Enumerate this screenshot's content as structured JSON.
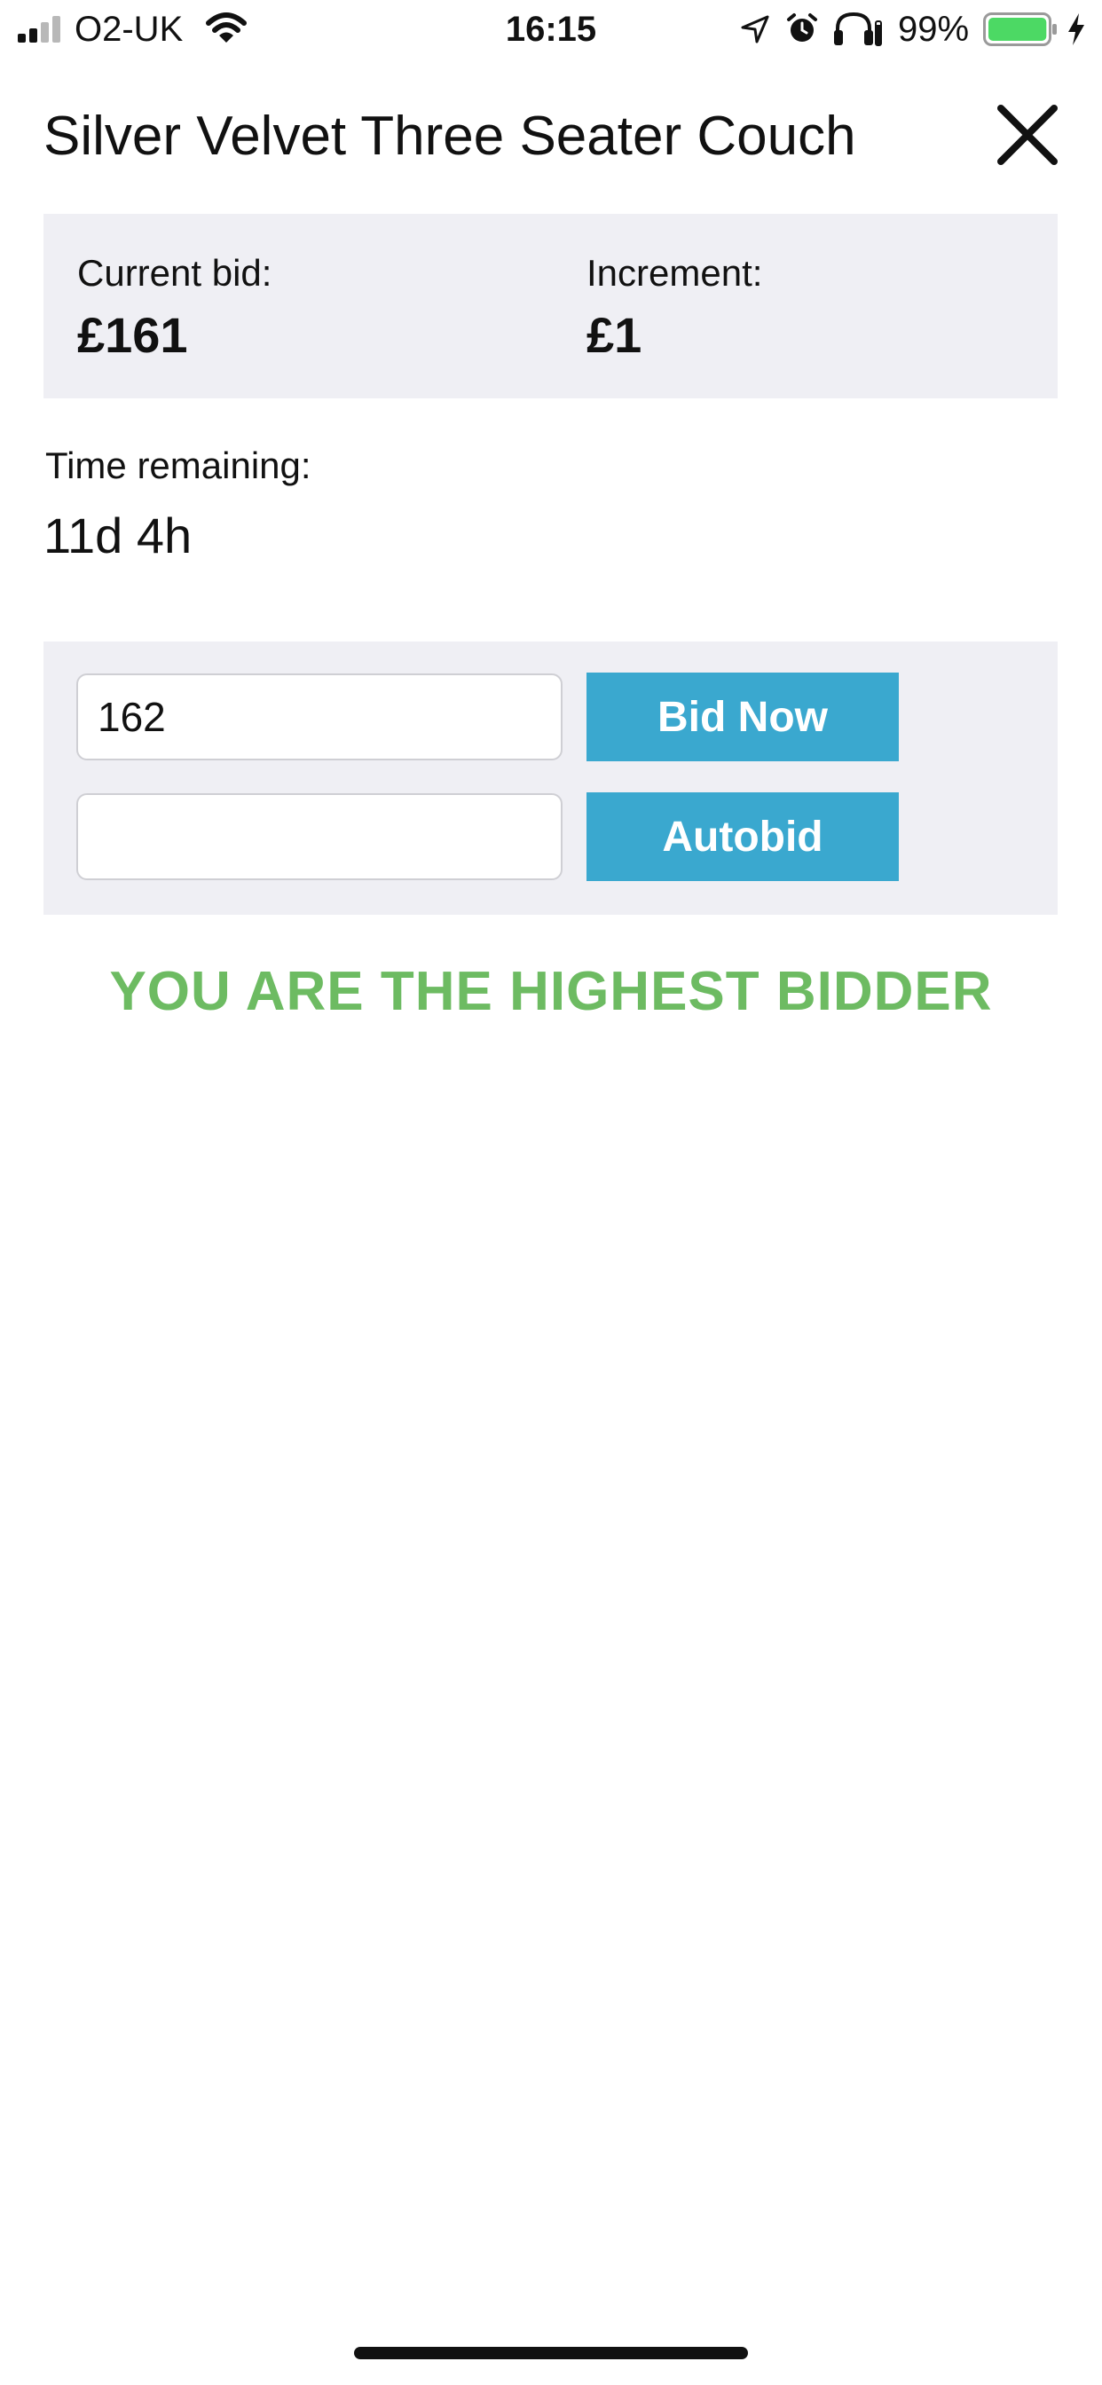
{
  "status_bar": {
    "carrier": "O2-UK",
    "time": "16:15",
    "battery_percent": "99%",
    "battery_level": 0.99,
    "icons": [
      "signal-icon",
      "wifi-icon",
      "location-arrow-icon",
      "alarm-icon",
      "headphones-icon",
      "battery-icon",
      "charging-icon"
    ]
  },
  "header": {
    "title": "Silver Velvet Three Seater Couch",
    "close_icon": "close-icon"
  },
  "bid_info": {
    "current_bid_label": "Current bid:",
    "current_bid_value": "£161",
    "increment_label": "Increment:",
    "increment_value": "£1"
  },
  "time_remaining": {
    "label": "Time remaining:",
    "value": "11d 4h"
  },
  "bid_form": {
    "bid_amount_value": "162",
    "bid_now_label": "Bid Now",
    "autobid_value": "",
    "autobid_label": "Autobid"
  },
  "status_message": "YOU ARE THE HIGHEST BIDDER",
  "colors": {
    "panel_background": "#efeff4",
    "button_background": "#3aa8cf",
    "success_text": "#6dbb62",
    "battery_fill": "#4cd964"
  }
}
